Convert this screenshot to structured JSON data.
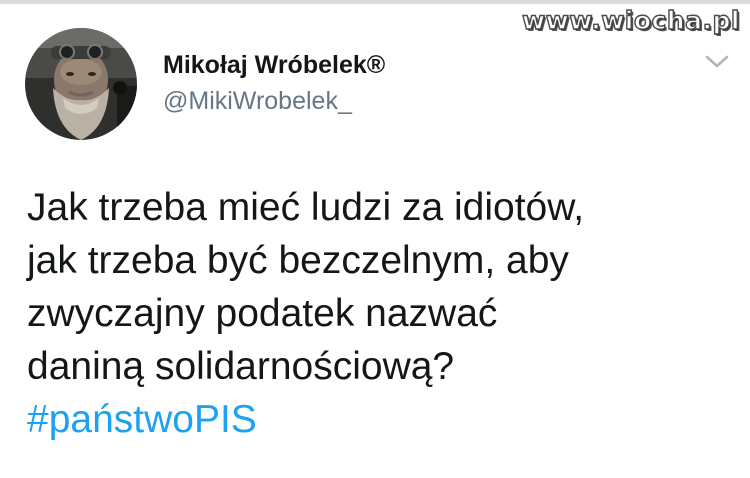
{
  "watermark": {
    "text": "www.wiocha.pl"
  },
  "tweet": {
    "author": {
      "display_name": "Mikołaj Wróbelek®",
      "handle": "@MikiWrobelek_",
      "avatar_icon": "avatar-photo-bearded-man"
    },
    "menu_icon": "chevron-down-icon",
    "text_lines": [
      "Jak trzeba mieć ludzi za idiotów,",
      "jak trzeba być bezczelnym, aby",
      "zwyczajny podatek nazwać",
      "daniną solidarnościową?"
    ],
    "hashtag": "#państwoPIS"
  },
  "colors": {
    "text": "#14171a",
    "secondary": "#657786",
    "hashtag": "#1da1f2",
    "background": "#ffffff",
    "divider": "#d9dde1"
  }
}
